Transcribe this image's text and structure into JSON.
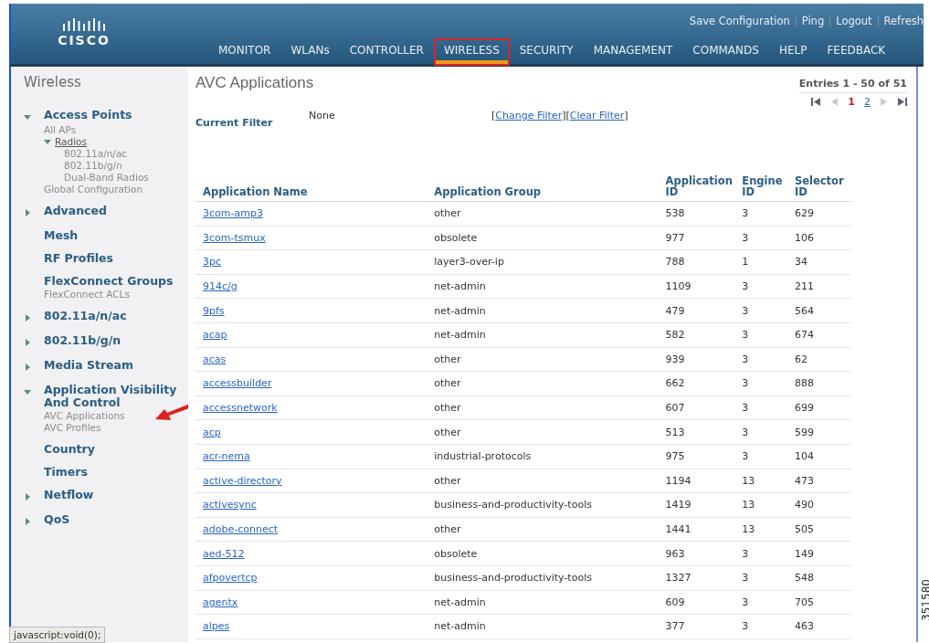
{
  "header": {
    "logo": "CISCO",
    "top_links": [
      "Save Configuration",
      "Ping",
      "Logout",
      "Refresh"
    ],
    "menu": [
      {
        "label": "MONITOR",
        "selected": false,
        "highlighted": false
      },
      {
        "label": "WLANs",
        "selected": false,
        "highlighted": false
      },
      {
        "label": "CONTROLLER",
        "selected": false,
        "highlighted": false
      },
      {
        "label": "WIRELESS",
        "selected": true,
        "highlighted": true
      },
      {
        "label": "SECURITY",
        "selected": false,
        "highlighted": false
      },
      {
        "label": "MANAGEMENT",
        "selected": false,
        "highlighted": false
      },
      {
        "label": "COMMANDS",
        "selected": false,
        "highlighted": false
      },
      {
        "label": "HELP",
        "selected": false,
        "highlighted": false
      },
      {
        "label": "FEEDBACK",
        "selected": false,
        "highlighted": false
      }
    ]
  },
  "sidebar": {
    "title": "Wireless",
    "items": [
      {
        "label": "Access Points",
        "expanded": true,
        "children": [
          {
            "label": "All APs"
          },
          {
            "label": "Radios",
            "expanded": true,
            "children": [
              {
                "label": "802.11a/n/ac"
              },
              {
                "label": "802.11b/g/n"
              },
              {
                "label": "Dual-Band Radios"
              }
            ]
          },
          {
            "label": "Global Configuration"
          }
        ]
      },
      {
        "label": "Advanced",
        "expanded": false
      },
      {
        "label": "Mesh"
      },
      {
        "label": "RF Profiles"
      },
      {
        "label": "FlexConnect Groups",
        "children": [
          {
            "label": "FlexConnect ACLs"
          }
        ]
      },
      {
        "label": "802.11a/n/ac",
        "expanded": false
      },
      {
        "label": "802.11b/g/n",
        "expanded": false
      },
      {
        "label": "Media Stream",
        "expanded": false
      },
      {
        "label": "Application Visibility And Control",
        "expanded": true,
        "children": [
          {
            "label": "AVC Applications",
            "pointed": true
          },
          {
            "label": "AVC Profiles",
            "pointed": false
          }
        ]
      },
      {
        "label": "Country"
      },
      {
        "label": "Timers"
      },
      {
        "label": "Netflow",
        "expanded": false
      },
      {
        "label": "QoS",
        "expanded": false
      }
    ]
  },
  "page": {
    "title": "AVC Applications",
    "entries": "Entries 1 - 50 of 51",
    "pagination": [
      {
        "kind": "first",
        "disabled": false
      },
      {
        "kind": "prev",
        "disabled": true
      },
      {
        "kind": "page",
        "label": "1",
        "selected": true
      },
      {
        "kind": "page",
        "label": "2",
        "selected": false
      },
      {
        "kind": "next",
        "disabled": true
      },
      {
        "kind": "last",
        "disabled": false
      }
    ],
    "filter_label": "Current Filter",
    "filter_value": "None",
    "filter_links": [
      {
        "open": "[",
        "label": "Change Filter",
        "close": "]"
      },
      {
        "open": "[",
        "label": "Clear Filter",
        "close": "]"
      }
    ]
  },
  "table": {
    "columns": [
      "Application Name",
      "Application Group",
      "Application ID",
      "Engine ID",
      "Selector ID"
    ],
    "rows": [
      [
        "3com-amp3",
        "other",
        "538",
        "3",
        "629"
      ],
      [
        "3com-tsmux",
        "obsolete",
        "977",
        "3",
        "106"
      ],
      [
        "3pc",
        "layer3-over-ip",
        "788",
        "1",
        "34"
      ],
      [
        "914c/g",
        "net-admin",
        "1109",
        "3",
        "211"
      ],
      [
        "9pfs",
        "net-admin",
        "479",
        "3",
        "564"
      ],
      [
        "acap",
        "net-admin",
        "582",
        "3",
        "674"
      ],
      [
        "acas",
        "other",
        "939",
        "3",
        "62"
      ],
      [
        "accessbuilder",
        "other",
        "662",
        "3",
        "888"
      ],
      [
        "accessnetwork",
        "other",
        "607",
        "3",
        "699"
      ],
      [
        "acp",
        "other",
        "513",
        "3",
        "599"
      ],
      [
        "acr-nema",
        "industrial-protocols",
        "975",
        "3",
        "104"
      ],
      [
        "active-directory",
        "other",
        "1194",
        "13",
        "473"
      ],
      [
        "activesync",
        "business-and-productivity-tools",
        "1419",
        "13",
        "490"
      ],
      [
        "adobe-connect",
        "other",
        "1441",
        "13",
        "505"
      ],
      [
        "aed-512",
        "obsolete",
        "963",
        "3",
        "149"
      ],
      [
        "afpovertcp",
        "business-and-productivity-tools",
        "1327",
        "3",
        "548"
      ],
      [
        "agentx",
        "net-admin",
        "609",
        "3",
        "705"
      ],
      [
        "alpes",
        "net-admin",
        "377",
        "3",
        "463"
      ]
    ]
  },
  "status_bar": "javascript:void(0);",
  "figure_id": "351580"
}
